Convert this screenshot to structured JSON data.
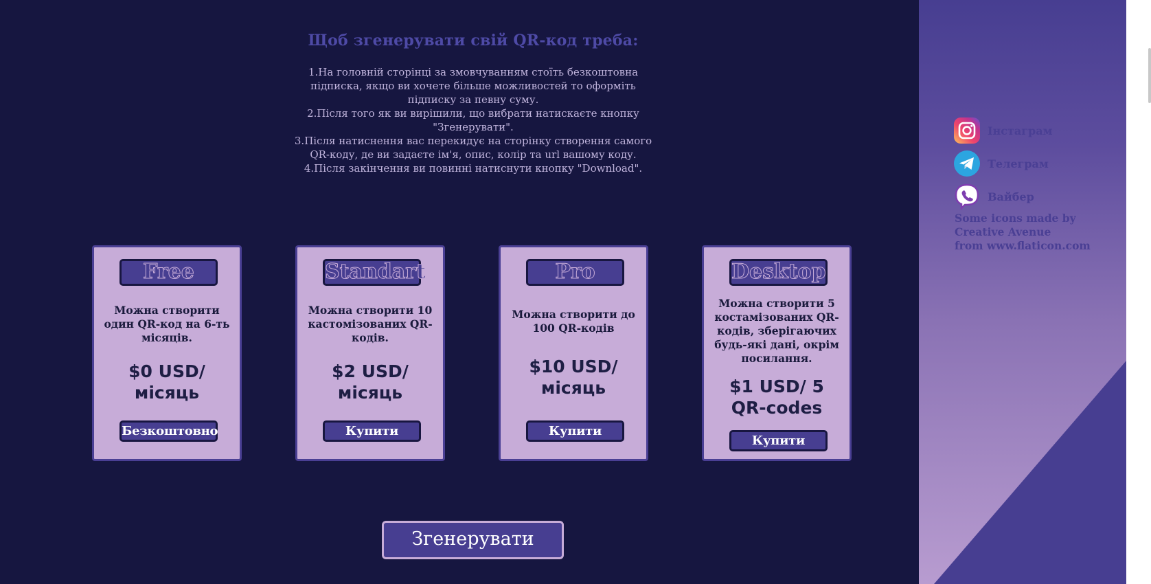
{
  "intro": {
    "title": "Щоб згенерувати свій QR-код треба:",
    "steps": [
      "1.На головній сторінці за змовчуванням стоїть безкоштовна підписка, якщо ви хочете більше можливостей то оформіть підписку за певну суму.",
      "2.Після того як ви вирішили, що вибрати натискаєте кнопку \"Згенерувати\".",
      "3.Після натиснення вас перекидує на сторінку створення самого QR-коду, де ви задаєте ім'я, опис, колір та url вашому коду.",
      "4.Після закінчення ви повинні натиснути кнопку \"Download\"."
    ]
  },
  "plans": [
    {
      "title": "Free",
      "description": "Можна створити один QR-код на 6-ть місяців.",
      "price": "$0 USD/ місяць",
      "button": "Безкоштовно"
    },
    {
      "title": "Standart",
      "description": "Можна створити 10 кастомізованих QR-кодів.",
      "price": "$2 USD/ місяць",
      "button": "Купити"
    },
    {
      "title": "Pro",
      "description": "Можна створити до 100 QR-кодів",
      "price": "$10 USD/ місяць",
      "button": "Купити"
    },
    {
      "title": "Desktop",
      "description": "Можна створити 5 костамізованих QR-кодів, зберігаючих будь-які дані, окрім посилання.",
      "price": "$1 USD/ 5 QR-codes",
      "button": "Купити"
    }
  ],
  "generate_button": "Згенерувати",
  "sidebar": {
    "socials": [
      {
        "label": "Інстаграм",
        "icon": "instagram-icon"
      },
      {
        "label": "Телеграм",
        "icon": "telegram-icon"
      },
      {
        "label": "Вайбер",
        "icon": "viber-icon"
      }
    ],
    "credit_lines": [
      "Some icons made by",
      "Creative Avenue",
      "from www.flaticon.com"
    ]
  },
  "colors": {
    "background": "#161640",
    "card": "#c7acd8",
    "accent": "#473e91",
    "title_text": "#4e4aa6"
  }
}
